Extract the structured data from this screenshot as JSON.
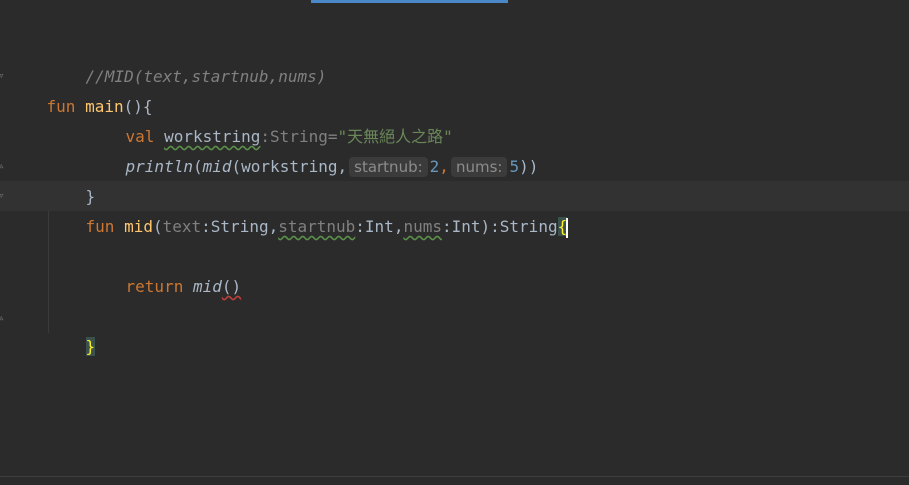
{
  "editor": {
    "lines": [
      {
        "comment": "//MID(text,startnub,nums)"
      },
      {
        "kw": "fun",
        "name": "main",
        "rest": "(){"
      },
      {
        "kw": "val",
        "var": "workstring",
        "colon": ":",
        "type": "String",
        "eq": "=",
        "str": "\"天無絕人之路\""
      },
      {
        "fn": "println",
        "call": "mid",
        "arg": "workstring,",
        "hint1": "startnub:",
        "v1": "2",
        "hint2": "nums:",
        "v2": "5",
        "close": "))"
      },
      {
        "brace": "}"
      },
      {
        "kw": "fun",
        "name": "mid",
        "p1": "text",
        "t1": ":String,",
        "p2": "startnub",
        "t2": ":Int,",
        "p3": "nums",
        "t3": ":Int):String",
        "open": "{"
      },
      {
        "kw": "return",
        "call": "mid",
        "parens": "()"
      },
      {
        "brace": "}"
      }
    ]
  },
  "colors": {
    "background": "#2b2b2b",
    "keyword": "#cc7832",
    "function": "#ffc66d",
    "string": "#6a8759",
    "number": "#6897bb",
    "comment": "#808080",
    "accent": "#4a88c7"
  }
}
